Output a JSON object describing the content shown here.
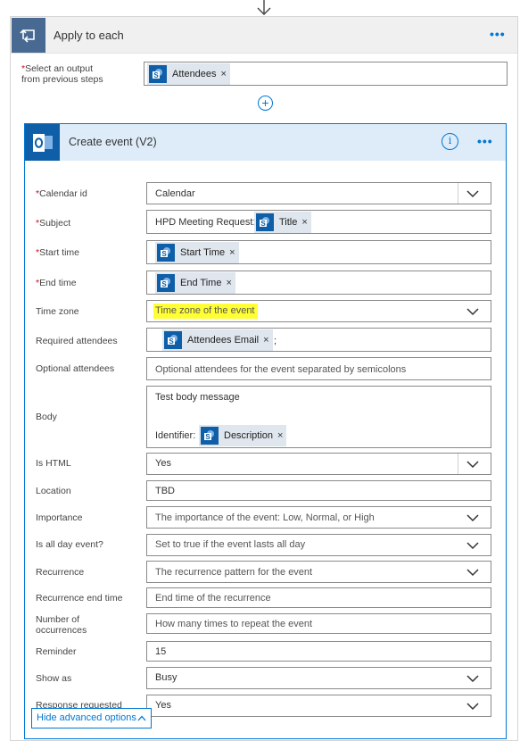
{
  "loop": {
    "title": "Apply to each",
    "more_label": "•••",
    "select_label_required": "*",
    "select_label_line1": "Select an output",
    "select_label_line2": "from previous steps",
    "select_token": "Attendees",
    "token_remove": "×"
  },
  "action": {
    "title": "Create event (V2)",
    "info_label": "i",
    "more_label": "•••",
    "hide_advanced": "Hide advanced options"
  },
  "fields": {
    "calendar_id": {
      "label": "Calendar id",
      "value": "Calendar"
    },
    "subject": {
      "label": "Subject",
      "prefix": "HPD Meeting Request:",
      "token": "Title"
    },
    "start_time": {
      "label": "Start time",
      "token": "Start Time"
    },
    "end_time": {
      "label": "End time",
      "token": "End Time"
    },
    "time_zone": {
      "label": "Time zone",
      "placeholder": "Time zone of the event"
    },
    "required_attendees": {
      "label": "Required attendees",
      "token": "Attendees Email",
      "suffix": ";"
    },
    "optional_attendees": {
      "label": "Optional attendees",
      "placeholder": "Optional attendees for the event separated by semicolons"
    },
    "body": {
      "label": "Body",
      "line1": "Test body message",
      "prefix": "Identifier:",
      "token": "Description"
    },
    "is_html": {
      "label": "Is HTML",
      "value": "Yes"
    },
    "location": {
      "label": "Location",
      "value": "TBD"
    },
    "importance": {
      "label": "Importance",
      "placeholder": "The importance of the event: Low, Normal, or High"
    },
    "is_all_day": {
      "label": "Is all day event?",
      "placeholder": "Set to true if the event lasts all day"
    },
    "recurrence": {
      "label": "Recurrence",
      "placeholder": "The recurrence pattern for the event"
    },
    "recurrence_end": {
      "label": "Recurrence end time",
      "placeholder": "End time of the recurrence"
    },
    "occurrences": {
      "label_line1": "Number of",
      "label_line2": "occurrences",
      "placeholder": "How many times to repeat the event"
    },
    "reminder": {
      "label": "Reminder",
      "value": "15"
    },
    "show_as": {
      "label": "Show as",
      "value": "Busy"
    },
    "response_requested": {
      "label": "Response requested",
      "value": "Yes"
    }
  },
  "colors": {
    "accent": "#0078d4",
    "loop_badge": "#486991",
    "token_bg": "#dfe6ee",
    "highlight": "#ffff33",
    "required": "#c50f1f"
  },
  "icons": {
    "down_arrow": "arrow-down-icon",
    "loop": "loop-icon",
    "outlook": "outlook-icon",
    "sharepoint": "sharepoint-icon",
    "add": "plus-circle-icon",
    "info": "info-icon",
    "chevron": "chevron-down-icon",
    "chevron_up": "chevron-up-icon"
  }
}
